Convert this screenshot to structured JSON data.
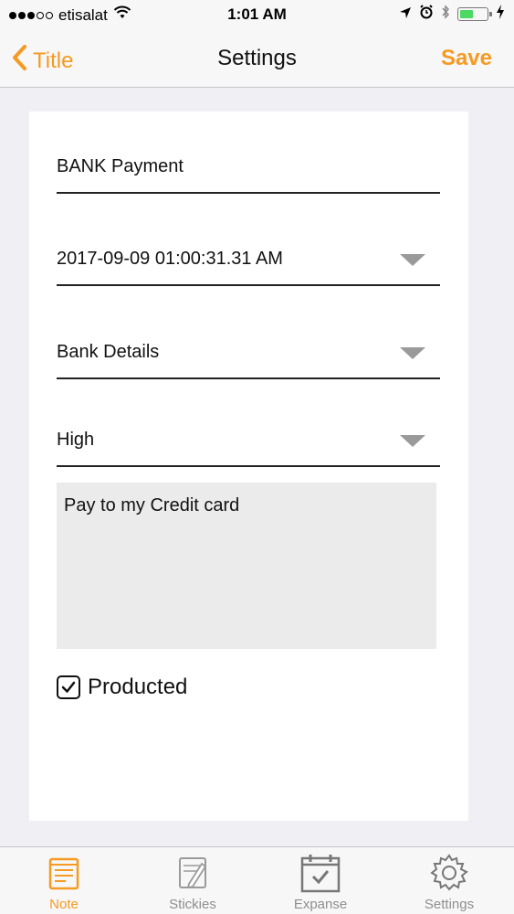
{
  "status_bar": {
    "carrier": "etisalat",
    "time": "1:01 AM"
  },
  "nav": {
    "back_label": "Title",
    "title": "Settings",
    "save_label": "Save"
  },
  "form": {
    "title_value": "BANK Payment",
    "date_value": "2017-09-09 01:00:31.31 AM",
    "category_value": "Bank Details",
    "priority_value": "High",
    "notes_value": "Pay to my Credit card",
    "checkbox_label": "Producted",
    "checkbox_checked": true
  },
  "tabs": [
    {
      "label": "Note",
      "icon": "note-icon",
      "active": true
    },
    {
      "label": "Stickies",
      "icon": "stickies-icon",
      "active": false
    },
    {
      "label": "Expanse",
      "icon": "calendar-icon",
      "active": false
    },
    {
      "label": "Settings",
      "icon": "gear-icon",
      "active": false
    }
  ],
  "colors": {
    "accent": "#f59a23",
    "inactive": "#8e8e93",
    "background": "#efeff4"
  }
}
